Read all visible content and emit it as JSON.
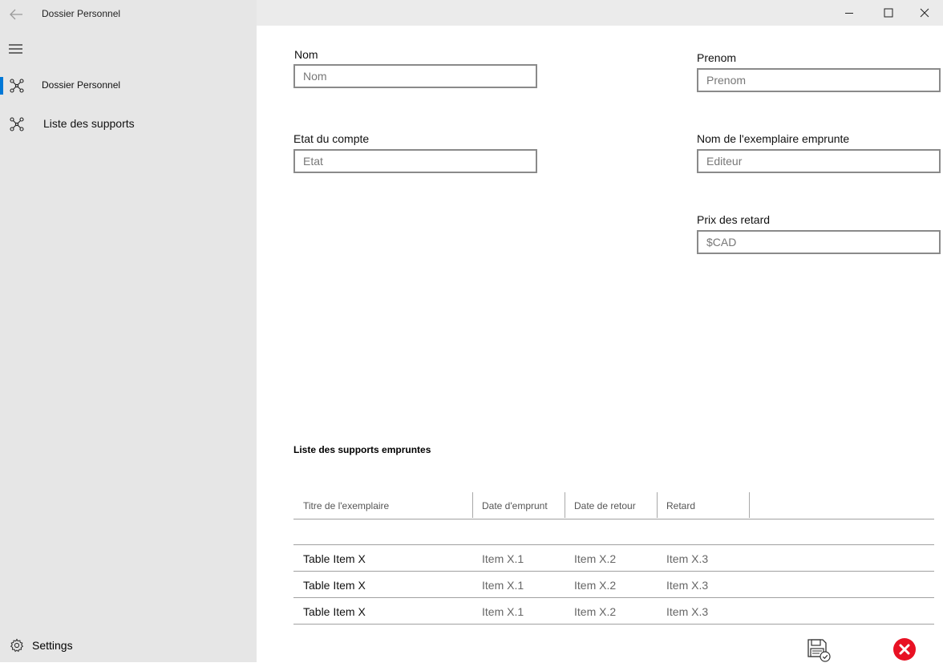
{
  "app": {
    "title": "Dossier Personnel"
  },
  "sidebar": {
    "items": [
      {
        "label": "Dossier Personnel",
        "icon": "network-icon",
        "selected": true
      },
      {
        "label": "Liste des supports",
        "icon": "network-icon",
        "selected": false
      }
    ],
    "settings_label": "Settings",
    "accent_color": "#0078d7"
  },
  "form": {
    "nom": {
      "label": "Nom",
      "placeholder": "Nom",
      "value": ""
    },
    "prenom": {
      "label": "Prenom",
      "placeholder": "Prenom",
      "value": ""
    },
    "etat": {
      "label": "Etat du compte",
      "placeholder": "Etat",
      "value": ""
    },
    "exemplaire": {
      "label": "Nom de l'exemplaire emprunte",
      "placeholder": "Editeur",
      "value": ""
    },
    "prix": {
      "label": "Prix des retard",
      "placeholder": "$CAD",
      "value": ""
    }
  },
  "table": {
    "title": "Liste des supports empruntes",
    "columns": [
      "Titre de l'exemplaire",
      "Date d'emprunt",
      "Date de retour",
      "Retard"
    ],
    "rows": [
      [
        "Table Item X",
        "Item X.1",
        "Item X.2",
        "Item X.3"
      ],
      [
        "Table Item X",
        "Item X.1",
        "Item X.2",
        "Item X.3"
      ],
      [
        "Table Item X",
        "Item X.1",
        "Item X.2",
        "Item X.3"
      ]
    ]
  },
  "actions": {
    "save_icon": "save-icon",
    "cancel_icon": "cancel-icon",
    "cancel_color": "#e81123"
  }
}
